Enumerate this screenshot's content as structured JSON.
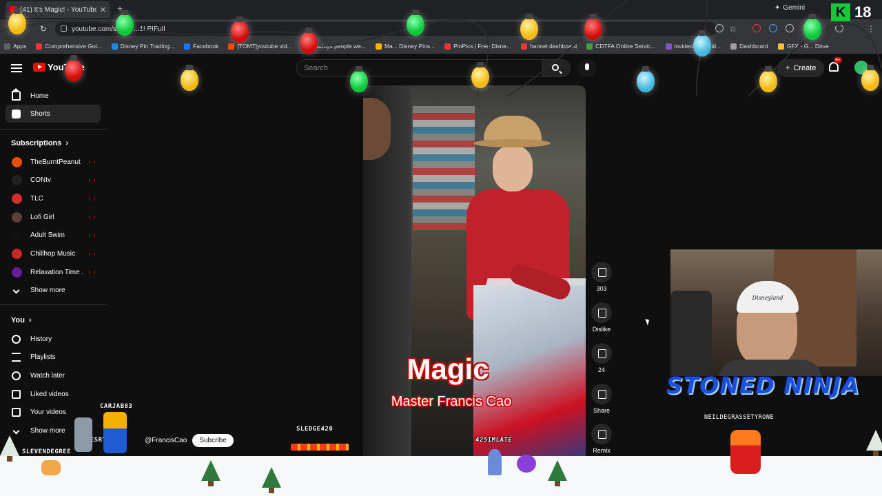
{
  "browser": {
    "tab_title": "(41) It's Magic! - YouTube",
    "url": "youtube.com/shorts/...1LPIFuIl",
    "gemini_label": "Gemini",
    "bookmarks": [
      {
        "label": "Apps",
        "color": "#5f6368"
      },
      {
        "label": "Comprehensive Gol...",
        "color": "#e53935"
      },
      {
        "label": "Disney Pin Trading...",
        "color": "#1e88e5"
      },
      {
        "label": "Facebook",
        "color": "#1877f2"
      },
      {
        "label": "[TOMT]youtube vid...",
        "color": "#ff4500"
      },
      {
        "label": "If todays people we...",
        "color": "#ff4500"
      },
      {
        "label": "Ma... Disney Pins...",
        "color": "#ffb300"
      },
      {
        "label": "PinPics | Free Disne...",
        "color": "#e53935"
      },
      {
        "label": "hannel dashboard",
        "color": "#e53935"
      },
      {
        "label": "CDTFA Online Servic...",
        "color": "#43a047"
      },
      {
        "label": "invideo",
        "color": "#7e57c2"
      },
      {
        "label": "id...",
        "color": "#8e24aa"
      },
      {
        "label": "Dashboard",
        "color": "#9e9e9e"
      },
      {
        "label": "GFX - G... Drive",
        "color": "#fbc02d"
      }
    ]
  },
  "header": {
    "logo_text": "YouTube",
    "search_placeholder": "Search",
    "create_label": "Create",
    "notif_badge": "9+"
  },
  "sidebar": {
    "home": "Home",
    "shorts": "Shorts",
    "subscriptions_heading": "Subscriptions",
    "subscriptions": [
      {
        "name": "TheBurntPeanut",
        "color": "#e65100"
      },
      {
        "name": "CONtv",
        "color": "#222222"
      },
      {
        "name": "TLC",
        "color": "#d32f2f"
      },
      {
        "name": "Lofi Girl",
        "color": "#5d4037"
      },
      {
        "name": "Adult Swim",
        "color": "#111111"
      },
      {
        "name": "Chillhop Music",
        "color": "#c62828"
      },
      {
        "name": "Relaxation Time ...",
        "color": "#6a1b9a"
      }
    ],
    "show_more": "Show more",
    "you_heading": "You",
    "you_items": [
      {
        "label": "History",
        "icon": "history-icon"
      },
      {
        "label": "Playlists",
        "icon": "playlists-icon"
      },
      {
        "label": "Watch later",
        "icon": "clock-icon"
      },
      {
        "label": "Liked videos",
        "icon": "like-icon"
      },
      {
        "label": "Your videos",
        "icon": "video-icon"
      }
    ],
    "show_more_2": "Show more"
  },
  "short": {
    "caption_title": "Magic",
    "caption_subtitle": "Master Francis Cao",
    "channel_handle": "@FrancisCao",
    "subscribe_label": "Subcribe",
    "likes": "303",
    "dislike_label": "Dislike",
    "comments": "24",
    "share_label": "Share",
    "remix_label": "Remix"
  },
  "stream_overlay": {
    "webcam_cap_text": "Disneyland",
    "banner": "STONED NINJA",
    "webcam_username": "NEILDEGRASSETYRONE",
    "kick_letter": "K",
    "viewer_count": "18",
    "chatters": [
      {
        "name": "CARJAB83"
      },
      {
        "name": "JAMESRYANXF"
      },
      {
        "name": "SLEVENDEGREE"
      },
      {
        "name": "SLEDGE420"
      },
      {
        "name": "425IMLATE"
      }
    ]
  }
}
